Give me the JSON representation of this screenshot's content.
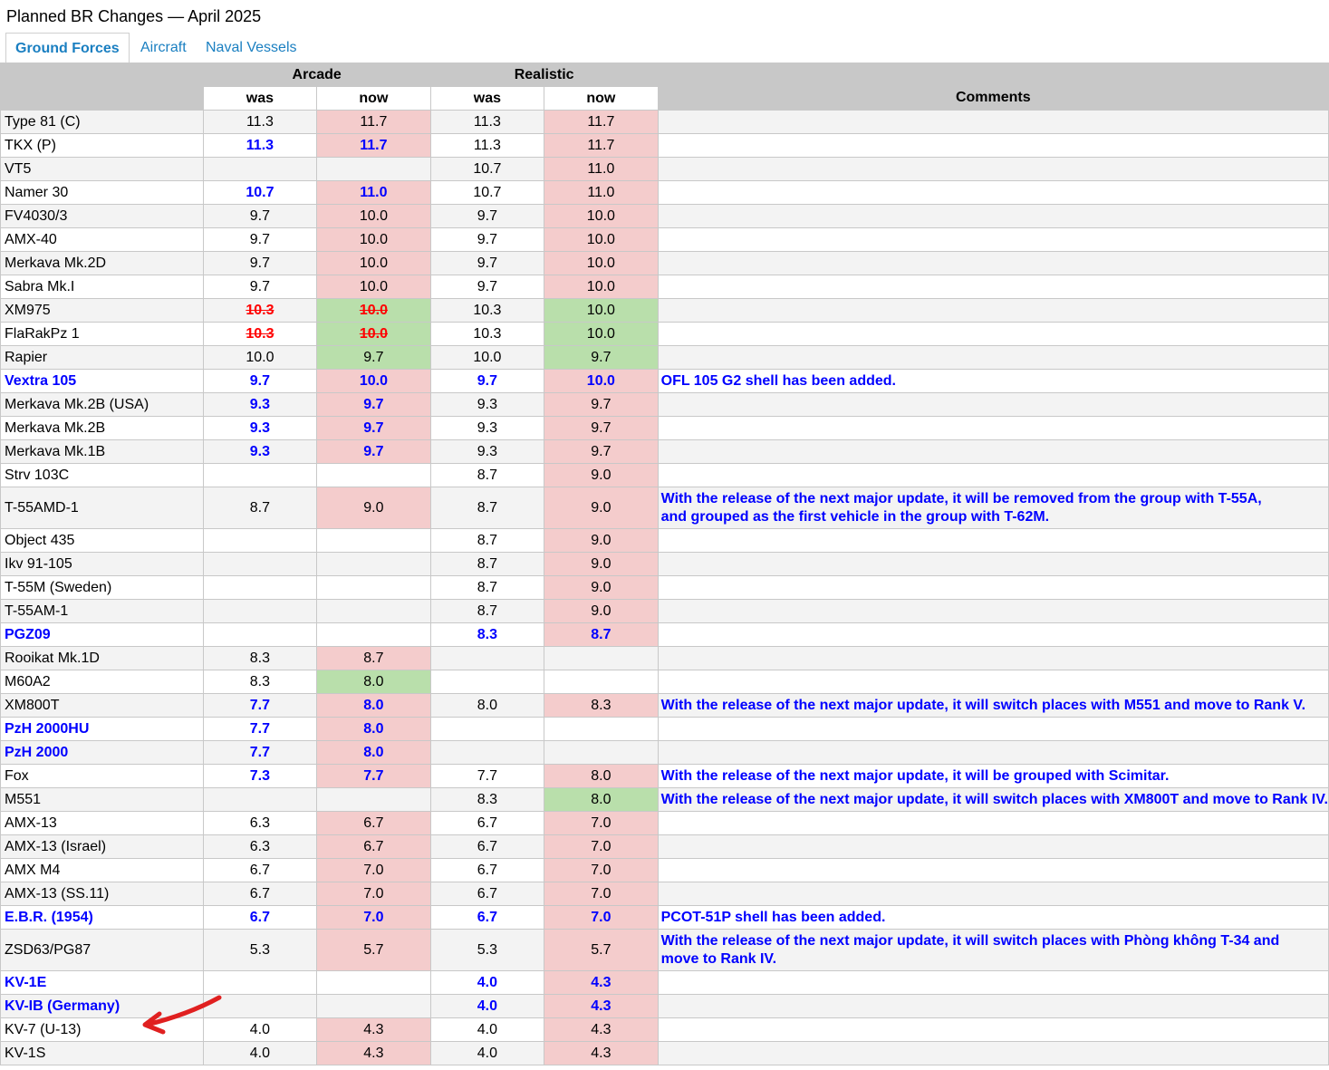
{
  "page": {
    "title": "Planned BR Changes — April 2025"
  },
  "tabs": [
    {
      "label": "Ground Forces",
      "active": true
    },
    {
      "label": "Aircraft",
      "active": false
    },
    {
      "label": "Naval Vessels",
      "active": false
    }
  ],
  "table": {
    "group_headers": {
      "arcade": "Arcade",
      "realistic": "Realistic",
      "comments": "Comments"
    },
    "sub_headers": {
      "was": "was",
      "now": "now"
    },
    "colors": {
      "increase": "#f4cccc",
      "decrease": "#b9dfab",
      "highlight_text": "#0000ff",
      "strike_text": "#ff0000"
    },
    "rows": [
      {
        "name": "Type 81 (C)",
        "ab_was": "11.3",
        "ab_now": "11.7",
        "ab_style": "",
        "ab_change": "up",
        "rb_was": "11.3",
        "rb_now": "11.7",
        "rb_style": "",
        "rb_change": "up",
        "name_style": "",
        "comment": "",
        "tall": false
      },
      {
        "name": "TKX (P)",
        "ab_was": "11.3",
        "ab_now": "11.7",
        "ab_style": "hl",
        "ab_change": "up",
        "rb_was": "11.3",
        "rb_now": "11.7",
        "rb_style": "",
        "rb_change": "up",
        "name_style": "",
        "comment": "",
        "tall": false
      },
      {
        "name": "VT5",
        "ab_was": "",
        "ab_now": "",
        "ab_style": "",
        "ab_change": "",
        "rb_was": "10.7",
        "rb_now": "11.0",
        "rb_style": "",
        "rb_change": "up",
        "name_style": "",
        "comment": "",
        "tall": false
      },
      {
        "name": "Namer 30",
        "ab_was": "10.7",
        "ab_now": "11.0",
        "ab_style": "hl",
        "ab_change": "up",
        "rb_was": "10.7",
        "rb_now": "11.0",
        "rb_style": "",
        "rb_change": "up",
        "name_style": "",
        "comment": "",
        "tall": false
      },
      {
        "name": "FV4030/3",
        "ab_was": "9.7",
        "ab_now": "10.0",
        "ab_style": "",
        "ab_change": "up",
        "rb_was": "9.7",
        "rb_now": "10.0",
        "rb_style": "",
        "rb_change": "up",
        "name_style": "",
        "comment": "",
        "tall": false
      },
      {
        "name": "AMX-40",
        "ab_was": "9.7",
        "ab_now": "10.0",
        "ab_style": "",
        "ab_change": "up",
        "rb_was": "9.7",
        "rb_now": "10.0",
        "rb_style": "",
        "rb_change": "up",
        "name_style": "",
        "comment": "",
        "tall": false
      },
      {
        "name": "Merkava Mk.2D",
        "ab_was": "9.7",
        "ab_now": "10.0",
        "ab_style": "",
        "ab_change": "up",
        "rb_was": "9.7",
        "rb_now": "10.0",
        "rb_style": "",
        "rb_change": "up",
        "name_style": "",
        "comment": "",
        "tall": false
      },
      {
        "name": "Sabra Mk.I",
        "ab_was": "9.7",
        "ab_now": "10.0",
        "ab_style": "",
        "ab_change": "up",
        "rb_was": "9.7",
        "rb_now": "10.0",
        "rb_style": "",
        "rb_change": "up",
        "name_style": "",
        "comment": "",
        "tall": false
      },
      {
        "name": "XM975",
        "ab_was": "10.3",
        "ab_now": "10.0",
        "ab_style": "strike",
        "ab_change": "down",
        "rb_was": "10.3",
        "rb_now": "10.0",
        "rb_style": "",
        "rb_change": "down",
        "name_style": "",
        "comment": "",
        "tall": false
      },
      {
        "name": "FlaRakPz 1",
        "ab_was": "10.3",
        "ab_now": "10.0",
        "ab_style": "strike",
        "ab_change": "down",
        "rb_was": "10.3",
        "rb_now": "10.0",
        "rb_style": "",
        "rb_change": "down",
        "name_style": "",
        "comment": "",
        "tall": false
      },
      {
        "name": "Rapier",
        "ab_was": "10.0",
        "ab_now": "9.7",
        "ab_style": "",
        "ab_change": "down",
        "rb_was": "10.0",
        "rb_now": "9.7",
        "rb_style": "",
        "rb_change": "down",
        "name_style": "",
        "comment": "",
        "tall": false
      },
      {
        "name": "Vextra 105",
        "ab_was": "9.7",
        "ab_now": "10.0",
        "ab_style": "hl",
        "ab_change": "up",
        "rb_was": "9.7",
        "rb_now": "10.0",
        "rb_style": "hl",
        "rb_change": "up",
        "name_style": "hl",
        "comment": "OFL 105 G2 shell has been added.",
        "tall": false
      },
      {
        "name": "Merkava Mk.2B (USA)",
        "ab_was": "9.3",
        "ab_now": "9.7",
        "ab_style": "hl",
        "ab_change": "up",
        "rb_was": "9.3",
        "rb_now": "9.7",
        "rb_style": "",
        "rb_change": "up",
        "name_style": "",
        "comment": "",
        "tall": false
      },
      {
        "name": "Merkava Mk.2B",
        "ab_was": "9.3",
        "ab_now": "9.7",
        "ab_style": "hl",
        "ab_change": "up",
        "rb_was": "9.3",
        "rb_now": "9.7",
        "rb_style": "",
        "rb_change": "up",
        "name_style": "",
        "comment": "",
        "tall": false
      },
      {
        "name": "Merkava Mk.1B",
        "ab_was": "9.3",
        "ab_now": "9.7",
        "ab_style": "hl",
        "ab_change": "up",
        "rb_was": "9.3",
        "rb_now": "9.7",
        "rb_style": "",
        "rb_change": "up",
        "name_style": "",
        "comment": "",
        "tall": false
      },
      {
        "name": "Strv 103C",
        "ab_was": "",
        "ab_now": "",
        "ab_style": "",
        "ab_change": "",
        "rb_was": "8.7",
        "rb_now": "9.0",
        "rb_style": "",
        "rb_change": "up",
        "name_style": "",
        "comment": "",
        "tall": false
      },
      {
        "name": "T-55AMD-1",
        "ab_was": "8.7",
        "ab_now": "9.0",
        "ab_style": "",
        "ab_change": "up",
        "rb_was": "8.7",
        "rb_now": "9.0",
        "rb_style": "",
        "rb_change": "up",
        "name_style": "",
        "comment": "With the release of the next major update, it will be removed from the group with T-55A,\nand grouped as the first vehicle in the group with T-62M.",
        "tall": true
      },
      {
        "name": "Object 435",
        "ab_was": "",
        "ab_now": "",
        "ab_style": "",
        "ab_change": "",
        "rb_was": "8.7",
        "rb_now": "9.0",
        "rb_style": "",
        "rb_change": "up",
        "name_style": "",
        "comment": "",
        "tall": false
      },
      {
        "name": "Ikv 91-105",
        "ab_was": "",
        "ab_now": "",
        "ab_style": "",
        "ab_change": "",
        "rb_was": "8.7",
        "rb_now": "9.0",
        "rb_style": "",
        "rb_change": "up",
        "name_style": "",
        "comment": "",
        "tall": false
      },
      {
        "name": "T-55M (Sweden)",
        "ab_was": "",
        "ab_now": "",
        "ab_style": "",
        "ab_change": "",
        "rb_was": "8.7",
        "rb_now": "9.0",
        "rb_style": "",
        "rb_change": "up",
        "name_style": "",
        "comment": "",
        "tall": false
      },
      {
        "name": "T-55AM-1",
        "ab_was": "",
        "ab_now": "",
        "ab_style": "",
        "ab_change": "",
        "rb_was": "8.7",
        "rb_now": "9.0",
        "rb_style": "",
        "rb_change": "up",
        "name_style": "",
        "comment": "",
        "tall": false
      },
      {
        "name": "PGZ09",
        "ab_was": "",
        "ab_now": "",
        "ab_style": "",
        "ab_change": "",
        "rb_was": "8.3",
        "rb_now": "8.7",
        "rb_style": "hl",
        "rb_change": "up",
        "name_style": "hl",
        "comment": "",
        "tall": false
      },
      {
        "name": "Rooikat Mk.1D",
        "ab_was": "8.3",
        "ab_now": "8.7",
        "ab_style": "",
        "ab_change": "up",
        "rb_was": "",
        "rb_now": "",
        "rb_style": "",
        "rb_change": "",
        "name_style": "",
        "comment": "",
        "tall": false
      },
      {
        "name": "M60A2",
        "ab_was": "8.3",
        "ab_now": "8.0",
        "ab_style": "",
        "ab_change": "down",
        "rb_was": "",
        "rb_now": "",
        "rb_style": "",
        "rb_change": "",
        "name_style": "",
        "comment": "",
        "tall": false
      },
      {
        "name": "XM800T",
        "ab_was": "7.7",
        "ab_now": "8.0",
        "ab_style": "hl",
        "ab_change": "up",
        "rb_was": "8.0",
        "rb_now": "8.3",
        "rb_style": "",
        "rb_change": "up",
        "name_style": "",
        "comment": "With the release of the next major update, it will switch places with M551 and move to Rank V.",
        "tall": false
      },
      {
        "name": "PzH 2000HU",
        "ab_was": "7.7",
        "ab_now": "8.0",
        "ab_style": "hl",
        "ab_change": "up",
        "rb_was": "",
        "rb_now": "",
        "rb_style": "",
        "rb_change": "",
        "name_style": "hl",
        "comment": "",
        "tall": false
      },
      {
        "name": "PzH 2000",
        "ab_was": "7.7",
        "ab_now": "8.0",
        "ab_style": "hl",
        "ab_change": "up",
        "rb_was": "",
        "rb_now": "",
        "rb_style": "",
        "rb_change": "",
        "name_style": "hl",
        "comment": "",
        "tall": false
      },
      {
        "name": "Fox",
        "ab_was": "7.3",
        "ab_now": "7.7",
        "ab_style": "hl",
        "ab_change": "up",
        "rb_was": "7.7",
        "rb_now": "8.0",
        "rb_style": "",
        "rb_change": "up",
        "name_style": "",
        "comment": "With the release of the next major update, it will be grouped with Scimitar.",
        "tall": false
      },
      {
        "name": "M551",
        "ab_was": "",
        "ab_now": "",
        "ab_style": "",
        "ab_change": "",
        "rb_was": "8.3",
        "rb_now": "8.0",
        "rb_style": "",
        "rb_change": "down",
        "name_style": "",
        "comment": "With the release of the next major update, it will switch places with XM800T and move to Rank IV.",
        "tall": false
      },
      {
        "name": "AMX-13",
        "ab_was": "6.3",
        "ab_now": "6.7",
        "ab_style": "",
        "ab_change": "up",
        "rb_was": "6.7",
        "rb_now": "7.0",
        "rb_style": "",
        "rb_change": "up",
        "name_style": "",
        "comment": "",
        "tall": false
      },
      {
        "name": "AMX-13 (Israel)",
        "ab_was": "6.3",
        "ab_now": "6.7",
        "ab_style": "",
        "ab_change": "up",
        "rb_was": "6.7",
        "rb_now": "7.0",
        "rb_style": "",
        "rb_change": "up",
        "name_style": "",
        "comment": "",
        "tall": false
      },
      {
        "name": "AMX M4",
        "ab_was": "6.7",
        "ab_now": "7.0",
        "ab_style": "",
        "ab_change": "up",
        "rb_was": "6.7",
        "rb_now": "7.0",
        "rb_style": "",
        "rb_change": "up",
        "name_style": "",
        "comment": "",
        "tall": false
      },
      {
        "name": "AMX-13 (SS.11)",
        "ab_was": "6.7",
        "ab_now": "7.0",
        "ab_style": "",
        "ab_change": "up",
        "rb_was": "6.7",
        "rb_now": "7.0",
        "rb_style": "",
        "rb_change": "up",
        "name_style": "",
        "comment": "",
        "tall": false
      },
      {
        "name": "E.B.R. (1954)",
        "ab_was": "6.7",
        "ab_now": "7.0",
        "ab_style": "hl",
        "ab_change": "up",
        "rb_was": "6.7",
        "rb_now": "7.0",
        "rb_style": "hl",
        "rb_change": "up",
        "name_style": "hl",
        "comment": "PCOT-51P shell has been added.",
        "tall": false
      },
      {
        "name": "ZSD63/PG87",
        "ab_was": "5.3",
        "ab_now": "5.7",
        "ab_style": "",
        "ab_change": "up",
        "rb_was": "5.3",
        "rb_now": "5.7",
        "rb_style": "",
        "rb_change": "up",
        "name_style": "",
        "comment": "With the release of the next major update, it will switch places with Phòng không T-34 and\nmove to Rank IV.",
        "tall": true
      },
      {
        "name": "KV-1E",
        "ab_was": "",
        "ab_now": "",
        "ab_style": "",
        "ab_change": "",
        "rb_was": "4.0",
        "rb_now": "4.3",
        "rb_style": "hl",
        "rb_change": "up",
        "name_style": "hl",
        "comment": "",
        "tall": false
      },
      {
        "name": "KV-IB (Germany)",
        "ab_was": "",
        "ab_now": "",
        "ab_style": "",
        "ab_change": "",
        "rb_was": "4.0",
        "rb_now": "4.3",
        "rb_style": "hl",
        "rb_change": "up",
        "name_style": "hl",
        "comment": "",
        "tall": false
      },
      {
        "name": "KV-7 (U-13)",
        "ab_was": "4.0",
        "ab_now": "4.3",
        "ab_style": "",
        "ab_change": "up",
        "rb_was": "4.0",
        "rb_now": "4.3",
        "rb_style": "",
        "rb_change": "up",
        "name_style": "",
        "comment": "",
        "tall": false
      },
      {
        "name": "KV-1S",
        "ab_was": "4.0",
        "ab_now": "4.3",
        "ab_style": "",
        "ab_change": "up",
        "rb_was": "4.0",
        "rb_now": "4.3",
        "rb_style": "",
        "rb_change": "up",
        "name_style": "",
        "comment": "",
        "tall": false
      }
    ]
  },
  "annotation": {
    "icon": "red-arrow-icon",
    "color": "#e02020"
  }
}
